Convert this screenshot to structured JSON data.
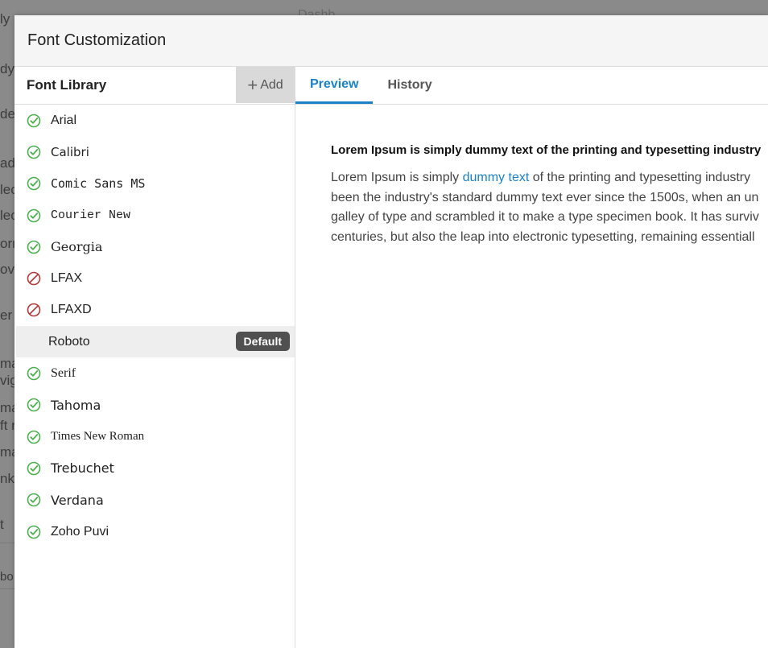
{
  "background": {
    "fragments": [
      "ly",
      "dy",
      "de",
      "ad",
      "lec",
      "lec",
      "orm",
      "ove",
      "er",
      "ma",
      "vig",
      "ma",
      "ft n",
      "ma",
      "nk c",
      "t",
      "bo"
    ],
    "top_fragment": "Dashb"
  },
  "modal": {
    "title": "Font Customization"
  },
  "sidebar": {
    "title": "Font Library",
    "add_label": "Add",
    "fonts": [
      {
        "name": "Arial",
        "status": "enabled",
        "icon": "check-circle-icon"
      },
      {
        "name": "Calibri",
        "status": "enabled",
        "icon": "check-circle-icon"
      },
      {
        "name": "Comic Sans MS",
        "status": "enabled",
        "icon": "check-circle-icon"
      },
      {
        "name": "Courier New",
        "status": "enabled",
        "icon": "check-circle-icon"
      },
      {
        "name": "Georgia",
        "status": "enabled",
        "icon": "check-circle-icon"
      },
      {
        "name": "LFAX",
        "status": "disabled",
        "icon": "prohibited-icon"
      },
      {
        "name": "LFAXD",
        "status": "disabled",
        "icon": "prohibited-icon"
      },
      {
        "name": "Roboto",
        "status": "default",
        "badge": "Default"
      },
      {
        "name": "Serif",
        "status": "enabled",
        "icon": "check-circle-icon"
      },
      {
        "name": "Tahoma",
        "status": "enabled",
        "icon": "check-circle-icon"
      },
      {
        "name": "Times New Roman",
        "status": "enabled",
        "icon": "check-circle-icon"
      },
      {
        "name": "Trebuchet",
        "status": "enabled",
        "icon": "check-circle-icon"
      },
      {
        "name": "Verdana",
        "status": "enabled",
        "icon": "check-circle-icon"
      },
      {
        "name": "Zoho Puvi",
        "status": "enabled",
        "icon": "check-circle-icon"
      }
    ]
  },
  "tabs": [
    {
      "label": "Preview",
      "active": true
    },
    {
      "label": "History",
      "active": false
    }
  ],
  "preview": {
    "heading": "Lorem Ipsum is simply dummy text of the printing and typesetting industry",
    "line1_before": "Lorem Ipsum is simply ",
    "line1_link": "dummy text",
    "line1_after": " of the printing and typesetting industry",
    "line2": "been the industry's standard dummy text ever since the 1500s, when an un",
    "line3": "galley of type and scrambled it to make a type specimen book. It has surviv",
    "line4": "centuries, but also the leap into electronic typesetting, remaining essentiall"
  },
  "colors": {
    "accent": "#1a82c7",
    "enabled": "#4caf50",
    "disabled": "#b03a3a",
    "badge": "#505050"
  }
}
